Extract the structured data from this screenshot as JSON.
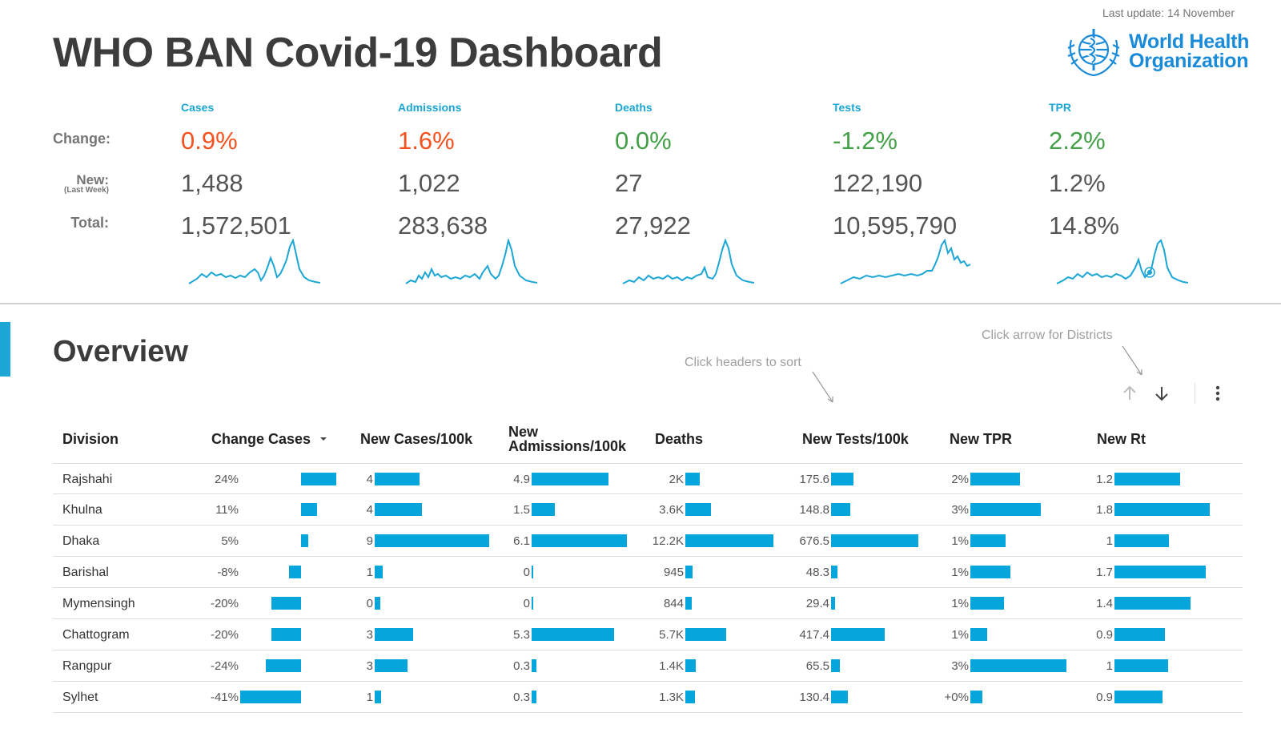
{
  "header": {
    "title": "WHO BAN Covid-19 Dashboard",
    "last_update": "Last update: 14 November",
    "logo": {
      "line1": "World Health",
      "line2": "Organization",
      "icon": "who-emblem-icon",
      "color": "#1a8bd8"
    }
  },
  "labels": {
    "change": "Change:",
    "new": "New:",
    "new_sub": "(Last Week)",
    "total": "Total:"
  },
  "colors": {
    "accent": "#1ba6d6",
    "bar": "#06a6dc",
    "increase": "#f4511e",
    "decrease": "#43a047"
  },
  "kpis": [
    {
      "name": "Cases",
      "change": "0.9%",
      "change_color": "#f4511e",
      "new": "1,488",
      "total": "1,572,501"
    },
    {
      "name": "Admissions",
      "change": "1.6%",
      "change_color": "#f4511e",
      "new": "1,022",
      "total": "283,638"
    },
    {
      "name": "Deaths",
      "change": "0.0%",
      "change_color": "#43a047",
      "new": "27",
      "total": "27,922"
    },
    {
      "name": "Tests",
      "change": "-1.2%",
      "change_color": "#43a047",
      "new": "122,190",
      "total": "10,595,790"
    },
    {
      "name": "TPR",
      "change": "2.2%",
      "change_color": "#43a047",
      "new": "1.2%",
      "total": "14.8%"
    }
  ],
  "overview": {
    "title": "Overview",
    "hint_sort": "Click headers to sort",
    "hint_districts": "Click arrow for Districts",
    "toolbar": {
      "up_icon": "arrow-up-icon",
      "down_icon": "arrow-down-icon",
      "more_icon": "more-vert-icon"
    }
  },
  "table": {
    "headers": [
      {
        "label": "Division"
      },
      {
        "label": "Change Cases",
        "sorted": "desc"
      },
      {
        "label": "New Cases/100k"
      },
      {
        "label": "New Admissions/100k",
        "line1": "New",
        "line2": "Admissions/100k"
      },
      {
        "label": "Deaths"
      },
      {
        "label": "New Tests/100k"
      },
      {
        "label": "New TPR"
      },
      {
        "label": "New Rt"
      }
    ],
    "rows": [
      {
        "division": "Rajshahi",
        "change": "24%",
        "change_val": 24,
        "cases": "4",
        "cases_val": 4,
        "adm": "4.9",
        "adm_val": 4.9,
        "deaths": "2K",
        "deaths_val": 2000,
        "tests": "175.6",
        "tests_val": 175.6,
        "tpr": "2%",
        "tpr_val": 2.1,
        "rt": "1.2",
        "rt_val": 1.2
      },
      {
        "division": "Khulna",
        "change": "11%",
        "change_val": 11,
        "cases": "4",
        "cases_val": 4.2,
        "adm": "1.5",
        "adm_val": 1.5,
        "deaths": "3.6K",
        "deaths_val": 3600,
        "tests": "148.8",
        "tests_val": 148.8,
        "tpr": "3%",
        "tpr_val": 3.0,
        "rt": "1.8",
        "rt_val": 1.75
      },
      {
        "division": "Dhaka",
        "change": "5%",
        "change_val": 5,
        "cases": "9",
        "cases_val": 10.2,
        "adm": "6.1",
        "adm_val": 6.1,
        "deaths": "12.2K",
        "deaths_val": 12200,
        "tests": "676.5",
        "tests_val": 676.5,
        "tpr": "1%",
        "tpr_val": 1.5,
        "rt": "1",
        "rt_val": 1.0
      },
      {
        "division": "Barishal",
        "change": "-8%",
        "change_val": -8,
        "cases": "1",
        "cases_val": 0.7,
        "adm": "0",
        "adm_val": 0,
        "deaths": "945",
        "deaths_val": 945,
        "tests": "48.3",
        "tests_val": 48.3,
        "tpr": "1%",
        "tpr_val": 1.7,
        "rt": "1.7",
        "rt_val": 1.68
      },
      {
        "division": "Mymensingh",
        "change": "-20%",
        "change_val": -20,
        "cases": "0",
        "cases_val": 0.5,
        "adm": "0",
        "adm_val": 0,
        "deaths": "844",
        "deaths_val": 844,
        "tests": "29.4",
        "tests_val": 29.4,
        "tpr": "1%",
        "tpr_val": 1.45,
        "rt": "1.4",
        "rt_val": 1.4
      },
      {
        "division": "Chattogram",
        "change": "-20%",
        "change_val": -20,
        "cases": "3",
        "cases_val": 3.4,
        "adm": "5.3",
        "adm_val": 5.3,
        "deaths": "5.7K",
        "deaths_val": 5700,
        "tests": "417.4",
        "tests_val": 417.4,
        "tpr": "1%",
        "tpr_val": 0.7,
        "rt": "0.9",
        "rt_val": 0.93
      },
      {
        "division": "Rangpur",
        "change": "-24%",
        "change_val": -24,
        "cases": "3",
        "cases_val": 2.9,
        "adm": "0.3",
        "adm_val": 0.3,
        "deaths": "1.4K",
        "deaths_val": 1400,
        "tests": "65.5",
        "tests_val": 65.5,
        "tpr": "3%",
        "tpr_val": 4.1,
        "rt": "1",
        "rt_val": 0.98
      },
      {
        "division": "Sylhet",
        "change": "-41%",
        "change_val": -41,
        "cases": "1",
        "cases_val": 0.6,
        "adm": "0.3",
        "adm_val": 0.3,
        "deaths": "1.3K",
        "deaths_val": 1300,
        "tests": "130.4",
        "tests_val": 130.4,
        "tpr": "+0%",
        "tpr_val": 0.5,
        "rt": "0.9",
        "rt_val": 0.88
      }
    ]
  }
}
